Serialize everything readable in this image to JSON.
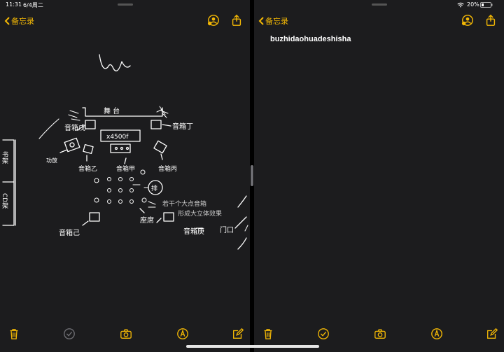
{
  "status_bar": {
    "time": "11:31",
    "date": "6/4周二",
    "battery_percent": "20%"
  },
  "left_pane": {
    "back_label": "备忘录",
    "sketch": {
      "labels": {
        "stage": "舞 台",
        "speaker_f": "音箱戊",
        "speaker_d": "音箱丁",
        "center_box": "x4500f",
        "amp": "功放",
        "speaker_b": "音箱乙",
        "speaker_a": "音箱甲",
        "speaker_c": "音箱丙",
        "fan": "排",
        "rack_books": "书架",
        "rack_cd": "CD架",
        "note_line1": "若干个大点音箱",
        "note_line2": "形成大立体效果",
        "seat": "座席",
        "speaker_e": "音箱庚",
        "speaker_g": "音箱己",
        "door": "门口"
      }
    }
  },
  "right_pane": {
    "back_label": "备忘录",
    "note_title": "buzhidaohuadeshisha"
  },
  "colors": {
    "accent": "#f2b705",
    "background": "#1c1c1e"
  }
}
